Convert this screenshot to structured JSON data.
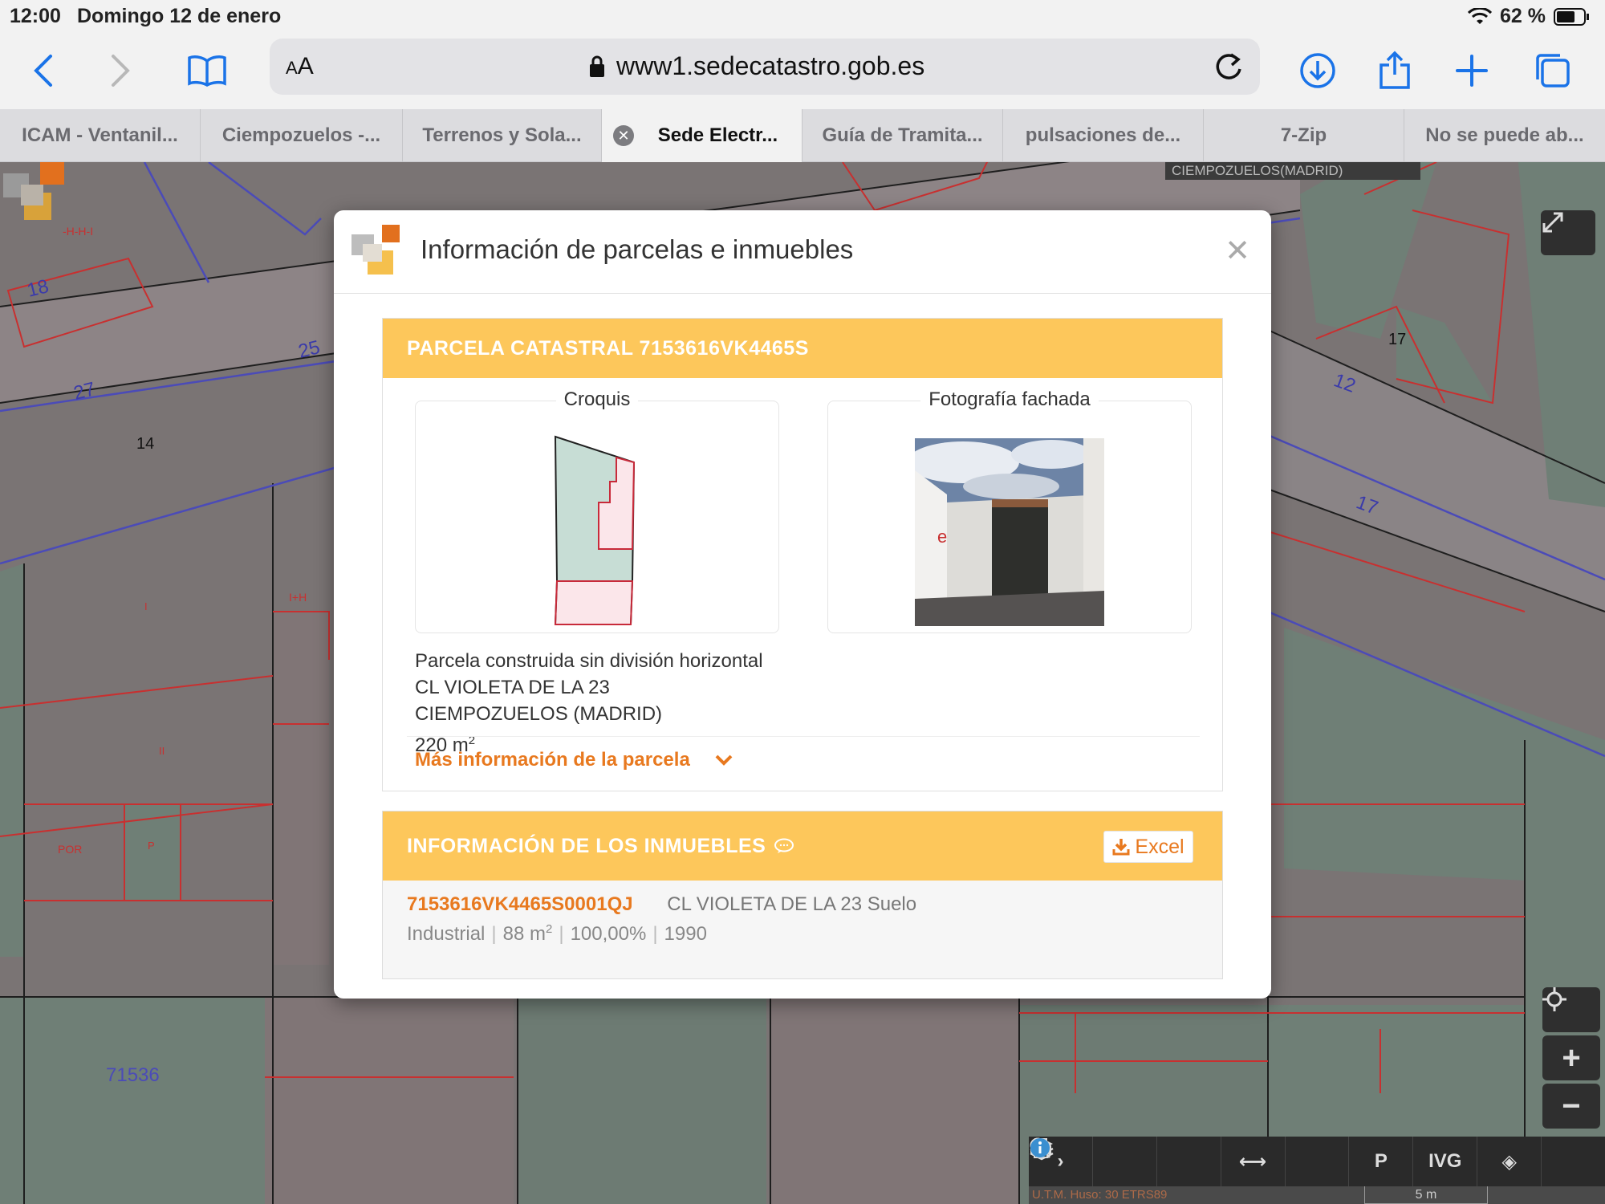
{
  "status_bar": {
    "time": "12:00",
    "date": "Domingo 12 de enero",
    "battery": "62 %"
  },
  "browser": {
    "text_size_label": "AA",
    "url": "www1.sedecatastro.gob.es",
    "tabs": [
      {
        "label": "ICAM - Ventanil...",
        "active": false
      },
      {
        "label": "Ciempozuelos -...",
        "active": false
      },
      {
        "label": "Terrenos y Sola...",
        "active": false
      },
      {
        "label": "Sede Electr...",
        "active": true
      },
      {
        "label": "Guía de Tramita...",
        "active": false
      },
      {
        "label": "pulsaciones de...",
        "active": false
      },
      {
        "label": "7-Zip",
        "active": false
      },
      {
        "label": "No se puede ab...",
        "active": false
      }
    ]
  },
  "map": {
    "region_label": "CIEMPOZUELOS(MADRID)",
    "labels": {
      "n18": "18",
      "n27": "27",
      "n25": "25",
      "n14": "14",
      "n17a": "17",
      "n12": "12",
      "n17b": "17",
      "hhh": "-H-H-I",
      "hi": "I+H",
      "por": "POR",
      "p1": "P",
      "ii": "II",
      "i": "I",
      "n71536": "71536"
    },
    "bottom_tools": [
      "›",
      "search",
      "layers",
      "measure",
      "print",
      "parking",
      "IVG",
      "cubes",
      "info"
    ],
    "utm": "U.T.M. Huso: 30 ETRS89",
    "scale": "5 m"
  },
  "modal": {
    "title": "Información de parcelas e inmuebles",
    "parcel_header": "PARCELA CATASTRAL 7153616VK4465S",
    "croquis_label": "Croquis",
    "foto_label": "Fotografía fachada",
    "parcel_type": "Parcela construida sin división horizontal",
    "address": "CL VIOLETA DE LA 23",
    "municipality": "CIEMPOZUELOS (MADRID)",
    "area_value": "220 m",
    "area_exp": "2",
    "more_info": "Más información de la parcela",
    "inmuebles_header": "INFORMACIÓN DE LOS INMUEBLES",
    "excel_label": "Excel",
    "record": {
      "ref": "7153616VK4465S0001QJ",
      "address": "CL VIOLETA DE LA 23 Suelo",
      "use": "Industrial",
      "area": "88 m",
      "area_exp": "2",
      "share": "100,00%",
      "year": "1990"
    }
  },
  "colors": {
    "accent_orange": "#e8791f",
    "header_yellow": "#fdc75b",
    "map_base": "#7a7474",
    "parcel_green": "#6f7f76",
    "plot_red": "#c83030"
  }
}
